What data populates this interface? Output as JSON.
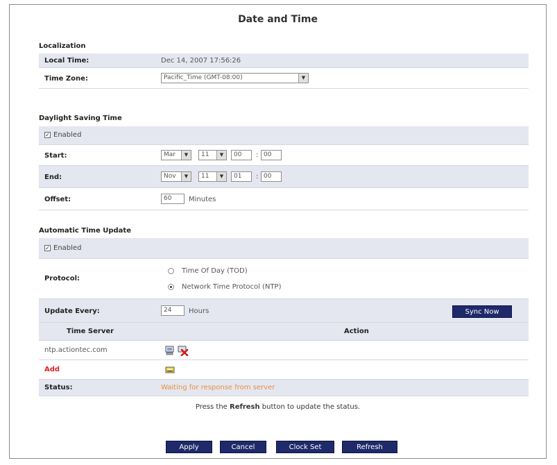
{
  "page": {
    "title": "Date and Time"
  },
  "localization": {
    "heading": "Localization",
    "local_time_label": "Local Time:",
    "local_time_value": "Dec 14, 2007 17:56:26",
    "time_zone_label": "Time Zone:",
    "time_zone_value": "Pacific_Time (GMT-08:00)"
  },
  "dst": {
    "heading": "Daylight Saving Time",
    "enabled_label": "Enabled",
    "enabled": true,
    "start_label": "Start:",
    "start_month": "Mar",
    "start_day": "11",
    "start_hour": "00",
    "start_minute": "00",
    "end_label": "End:",
    "end_month": "Nov",
    "end_day": "11",
    "end_hour": "01",
    "end_minute": "00",
    "time_sep": ":",
    "offset_label": "Offset:",
    "offset_value": "60",
    "offset_unit": "Minutes"
  },
  "auto_update": {
    "heading": "Automatic Time Update",
    "enabled_label": "Enabled",
    "enabled": true,
    "protocol_label": "Protocol:",
    "protocol_options": [
      "Time Of Day (TOD)",
      "Network Time Protocol (NTP)"
    ],
    "protocol_selected": "Network Time Protocol (NTP)",
    "update_every_label": "Update Every:",
    "update_every_value": "24",
    "update_every_unit": "Hours",
    "sync_now_label": "Sync Now",
    "time_server_header": "Time Server",
    "action_header": "Action",
    "server_name": "ntp.actiontec.com",
    "add_label": "Add",
    "status_label": "Status:",
    "status_value": "Waiting for response from server"
  },
  "note": {
    "prefix": "Press the ",
    "bold": "Refresh",
    "suffix": " button to update the status."
  },
  "buttons": {
    "apply": "Apply",
    "cancel": "Cancel",
    "clock_set": "Clock Set",
    "refresh": "Refresh"
  },
  "colors": {
    "button_bg": "#1f2a6b",
    "row_shade": "#e4e7f0",
    "status": "#e8903e",
    "add": "#dd2222"
  }
}
